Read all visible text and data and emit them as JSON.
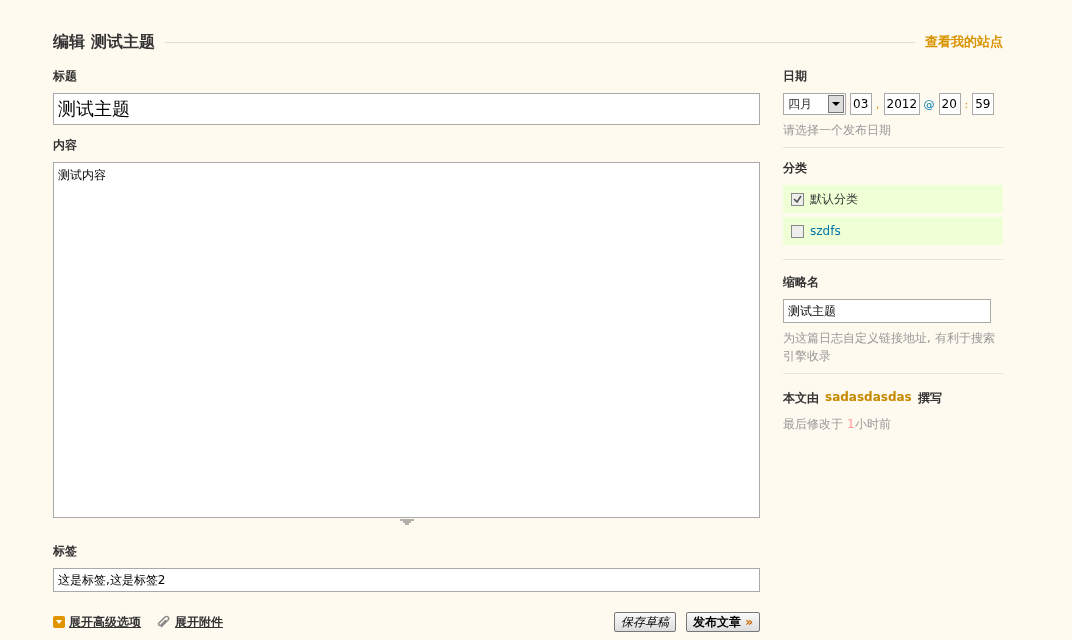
{
  "header": {
    "title": "编辑 测试主题",
    "view_site_link": "查看我的站点"
  },
  "editor": {
    "title_label": "标题",
    "title_value": "测试主题",
    "content_label": "内容",
    "content_value": "测试内容",
    "tags_label": "标签",
    "tags_value": "这是标签,这是标签2"
  },
  "actions": {
    "advanced_link": "展开高级选项",
    "attachments_link": "展开附件",
    "save_draft_button": "保存草稿",
    "publish_button": "发布文章",
    "publish_arrow": "»"
  },
  "sidebar": {
    "date": {
      "label": "日期",
      "month": "四月",
      "day": "03",
      "comma": ",",
      "year": "2012",
      "at": "@",
      "hour": "20",
      "colon": ":",
      "minute": "59",
      "hint": "请选择一个发布日期"
    },
    "categories": {
      "label": "分类",
      "items": [
        {
          "name": "默认分类",
          "checked": true
        },
        {
          "name": "szdfs",
          "checked": false
        }
      ]
    },
    "slug": {
      "label": "缩略名",
      "value": "测试主题",
      "hint": "为这篇日志自定义链接地址, 有利于搜索引擎收录"
    },
    "author": {
      "prefix": "本文由",
      "name": "sadasdasdas",
      "suffix": "撰写"
    },
    "modified": {
      "prefix": "最后修改于",
      "count": "1",
      "suffix": "小时前"
    }
  }
}
